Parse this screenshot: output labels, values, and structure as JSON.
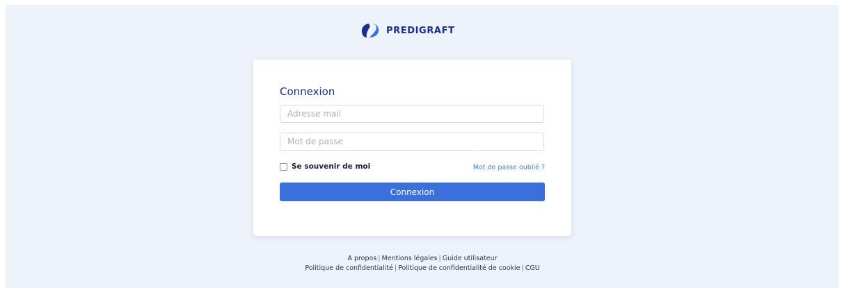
{
  "brand": {
    "name": "PREDIGRAFT",
    "colors": {
      "primary": "#1b2f8f",
      "accent": "#3b6fd9"
    }
  },
  "login": {
    "title": "Connexion",
    "email_placeholder": "Adresse mail",
    "password_placeholder": "Mot de passe",
    "remember_label": "Se souvenir de moi",
    "remember_checked": false,
    "forgot_label": "Mot de passe oublié ?",
    "submit_label": "Connexion"
  },
  "footer": {
    "row1": [
      "A propos",
      "Mentions légales",
      "Guide utilisateur"
    ],
    "row2": [
      "Politique de confidentialité",
      "Politique de confidentialité de cookie",
      "CGU"
    ],
    "separator": "|"
  }
}
